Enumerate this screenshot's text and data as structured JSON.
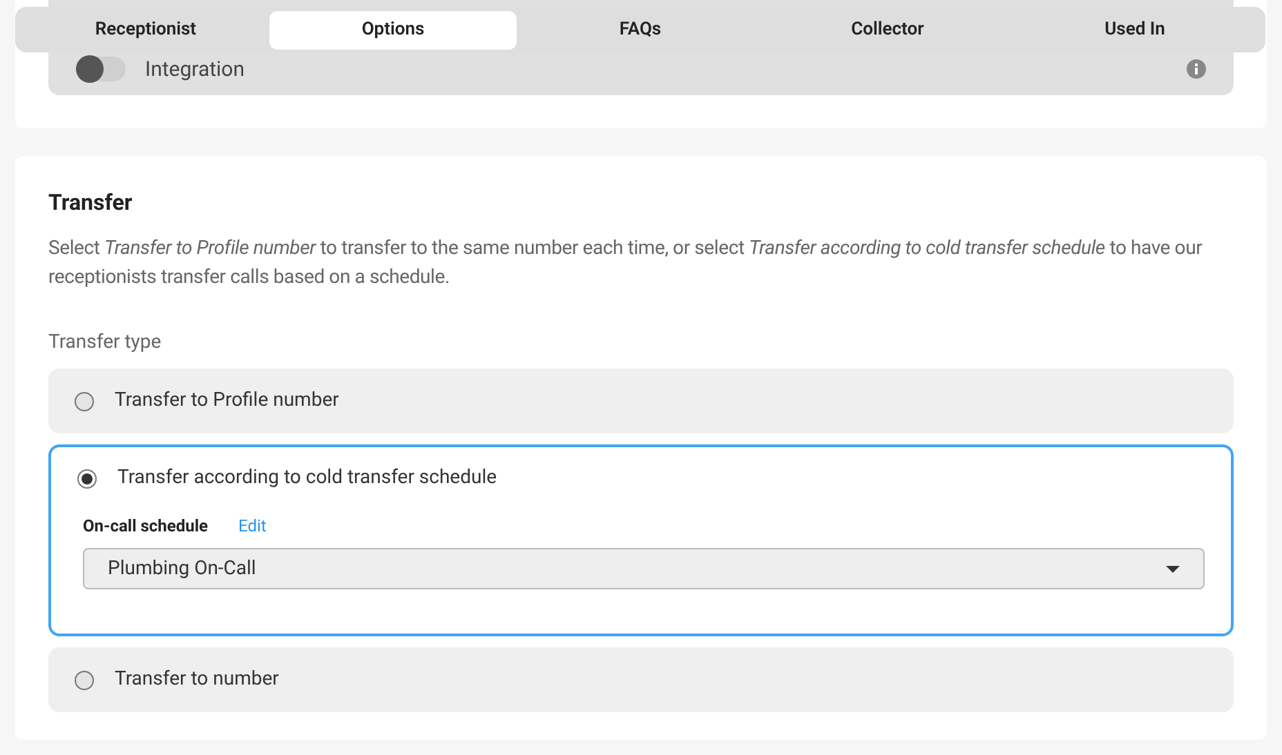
{
  "tabs": [
    {
      "label": "Receptionist",
      "selected": false
    },
    {
      "label": "Options",
      "selected": true
    },
    {
      "label": "FAQs",
      "selected": false
    },
    {
      "label": "Collector",
      "selected": false
    },
    {
      "label": "Used In",
      "selected": false
    }
  ],
  "integration": {
    "label": "Integration",
    "on": false
  },
  "transfer": {
    "title": "Transfer",
    "description": "Select *Transfer to Profile number* to transfer to the same number each time, or select *Transfer according to cold transfer schedule* to have our receptionists transfer calls based on a schedule.",
    "type_label": "Transfer type",
    "options": [
      {
        "label": "Transfer to Profile number",
        "selected": false
      },
      {
        "label": "Transfer according to cold transfer schedule",
        "selected": true,
        "schedule_label": "On-call schedule",
        "edit_link": "Edit",
        "schedule_value": "Plumbing On-Call"
      },
      {
        "label": "Transfer to number",
        "selected": false
      }
    ]
  }
}
